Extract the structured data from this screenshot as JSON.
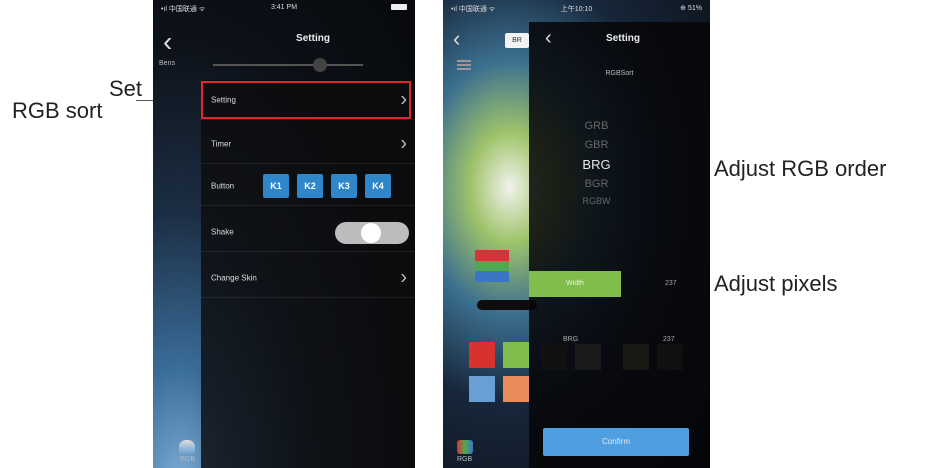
{
  "annotations": {
    "left_line1": "Set",
    "left_line2": "RGB sort",
    "right_top": "Adjust RGB order",
    "right_bottom": "Adjust pixels"
  },
  "phone1": {
    "status_left": "•ıl 中国联通 ᯤ",
    "status_center": "3:41 PM",
    "title": "Setting",
    "slider_label": "Bens",
    "rows": {
      "setting": "Setting",
      "timer": "Timer",
      "button": "Button",
      "shake": "Shake",
      "change_skin": "Change Skin"
    },
    "buttons": [
      "K1",
      "K2",
      "K3",
      "K4"
    ],
    "bottom_icon_label": "RGB"
  },
  "phone2": {
    "status_left": "•ıl 中国联通 ᯤ",
    "status_center": "上午10:10",
    "status_right": "⊕ 51%",
    "tab_label": "BR",
    "title": "Setting",
    "subtitle": "RGBSort",
    "options": [
      "GRB",
      "GBR",
      "BRG",
      "BGR",
      "RGBW"
    ],
    "selected_option": "BRG",
    "pixel_bar_label": "Width",
    "pixel_value": "237",
    "order_label": "BRG",
    "order_value": "237",
    "confirm_label": "Confirm",
    "bottom_icon_label": "RGB"
  },
  "colors": {
    "highlight": "#e0262b",
    "blue_button": "#2f86c9",
    "green_bar": "#7fbd4d",
    "confirm": "#4f9fe0"
  }
}
